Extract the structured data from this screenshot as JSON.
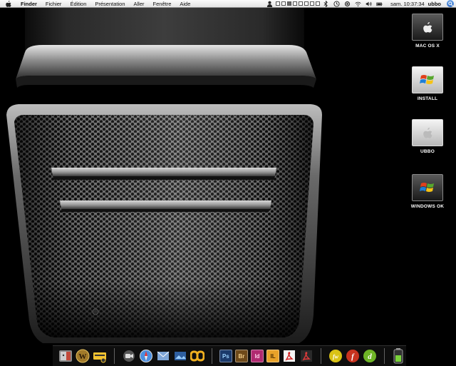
{
  "menubar": {
    "items": [
      "Finder",
      "Fichier",
      "Édition",
      "Présentation",
      "Aller",
      "Fenêtre",
      "Aide"
    ],
    "clock": "sam. 10:37:34",
    "user": "ubbo"
  },
  "desktop": {
    "icons": [
      {
        "label": "MAC OS X",
        "icon": "apple-logo-icon"
      },
      {
        "label": "INSTALL",
        "icon": "windows-logo-icon"
      },
      {
        "label": "UBBO",
        "icon": "apple-logo-icon"
      },
      {
        "label": "WINDOWS OK",
        "icon": "windows-logo-icon"
      }
    ]
  },
  "dock": {
    "adobe": [
      "Ps",
      "Br",
      "Id",
      "IL"
    ],
    "colors": {
      "photoshop": "#1b3a6b",
      "bridge": "#6e4a1a",
      "indesign": "#b02a71",
      "illustrator": "#e8a229"
    }
  }
}
